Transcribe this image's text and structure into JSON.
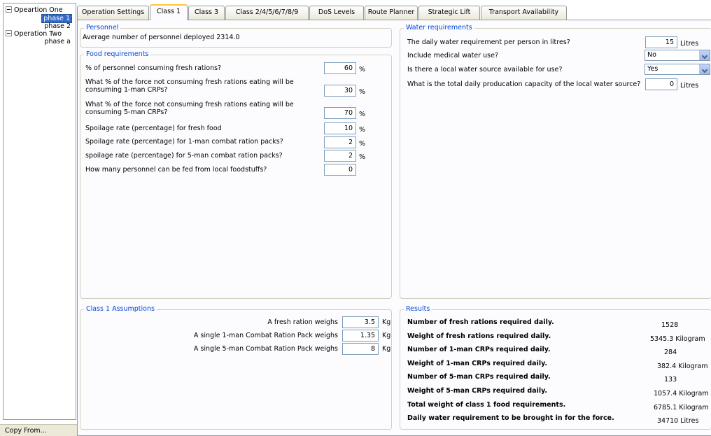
{
  "tree": {
    "nodes": [
      {
        "label": "Opeartion One",
        "children": [
          "phase 1",
          "phase 2"
        ]
      },
      {
        "label": "Operation Two",
        "children": [
          "phase a"
        ]
      }
    ],
    "selected": "phase 1"
  },
  "copy_from_label": "Copy From...",
  "tabs": [
    "Operation Settings",
    "Class 1",
    "Class 3",
    "Class 2/4/5/6/7/8/9",
    "DoS Levels",
    "Route Planner",
    "Strategic Lift",
    "Transport Availability"
  ],
  "active_tab": "Class 1",
  "personnel": {
    "title": "Personnel",
    "text": "Average number of personnel deployed 2314.0"
  },
  "food": {
    "title": "Food requirements",
    "rows": [
      {
        "label": "% of personnel consuming fresh rations?",
        "value": "60",
        "unit": "%"
      },
      {
        "label": "What % of the force not consuming fresh rations eating will be consuming 1-man CRPs?",
        "value": "30",
        "unit": "%"
      },
      {
        "label": "What % of the force not consuming fresh rations eating will be consuming 5-man CRPs?",
        "value": "70",
        "unit": "%"
      },
      {
        "label": "Spoilage rate (percentage) for fresh food",
        "value": "10",
        "unit": "%"
      },
      {
        "label": "Spoilage rate (percentage) for 1-man combat ration packs?",
        "value": "2",
        "unit": "%"
      },
      {
        "label": "spoilage rate (percentage) for 5-man combat ration packs?",
        "value": "2",
        "unit": "%"
      },
      {
        "label": "How many personnel can be fed from local foodstuffs?",
        "value": "0",
        "unit": ""
      }
    ]
  },
  "water": {
    "title": "Water requirements",
    "daily_label": "The daily water requirement per person in litres?",
    "daily_value": "15",
    "daily_unit": "Litres",
    "medical_label": "Include medical water use?",
    "medical_value": "No",
    "local_source_label": "Is there a local water source available for use?",
    "local_source_value": "Yes",
    "capacity_label": "What is the total daily producation capacity of the local water source?",
    "capacity_value": "0",
    "capacity_unit": "Litres"
  },
  "assumptions": {
    "title": "Class 1 Assumptions",
    "rows": [
      {
        "label": "A fresh ration weighs",
        "value": "3.5",
        "unit": "Kg"
      },
      {
        "label": "A single 1-man Combat Ration Pack weighs",
        "value": "1.35",
        "unit": "Kg"
      },
      {
        "label": "A single 5-man Combat Ration Pack weighs",
        "value": "8",
        "unit": "Kg"
      }
    ]
  },
  "results": {
    "title": "Results",
    "rows": [
      {
        "label": "Number of fresh rations required daily.",
        "value": "1528"
      },
      {
        "label": "Weight of fresh rations required daily.",
        "value": "5345.3 Kilogram"
      },
      {
        "label": "Number of 1-man CRPs required daily.",
        "value": "284"
      },
      {
        "label": "Weight of 1-man CRPs required daily.",
        "value": "382.4 Kilogram"
      },
      {
        "label": "Number of 5-man CRPs required daily.",
        "value": "133"
      },
      {
        "label": "Weight of 5-man CRPs required daily.",
        "value": "1057.4 Kilogram"
      },
      {
        "label": "Total weight of class 1 food requirements.",
        "value": "6785.1 Kilogram"
      },
      {
        "label": "Daily water requirement to be brought in for the force.",
        "value": "34710 Litres"
      }
    ]
  }
}
